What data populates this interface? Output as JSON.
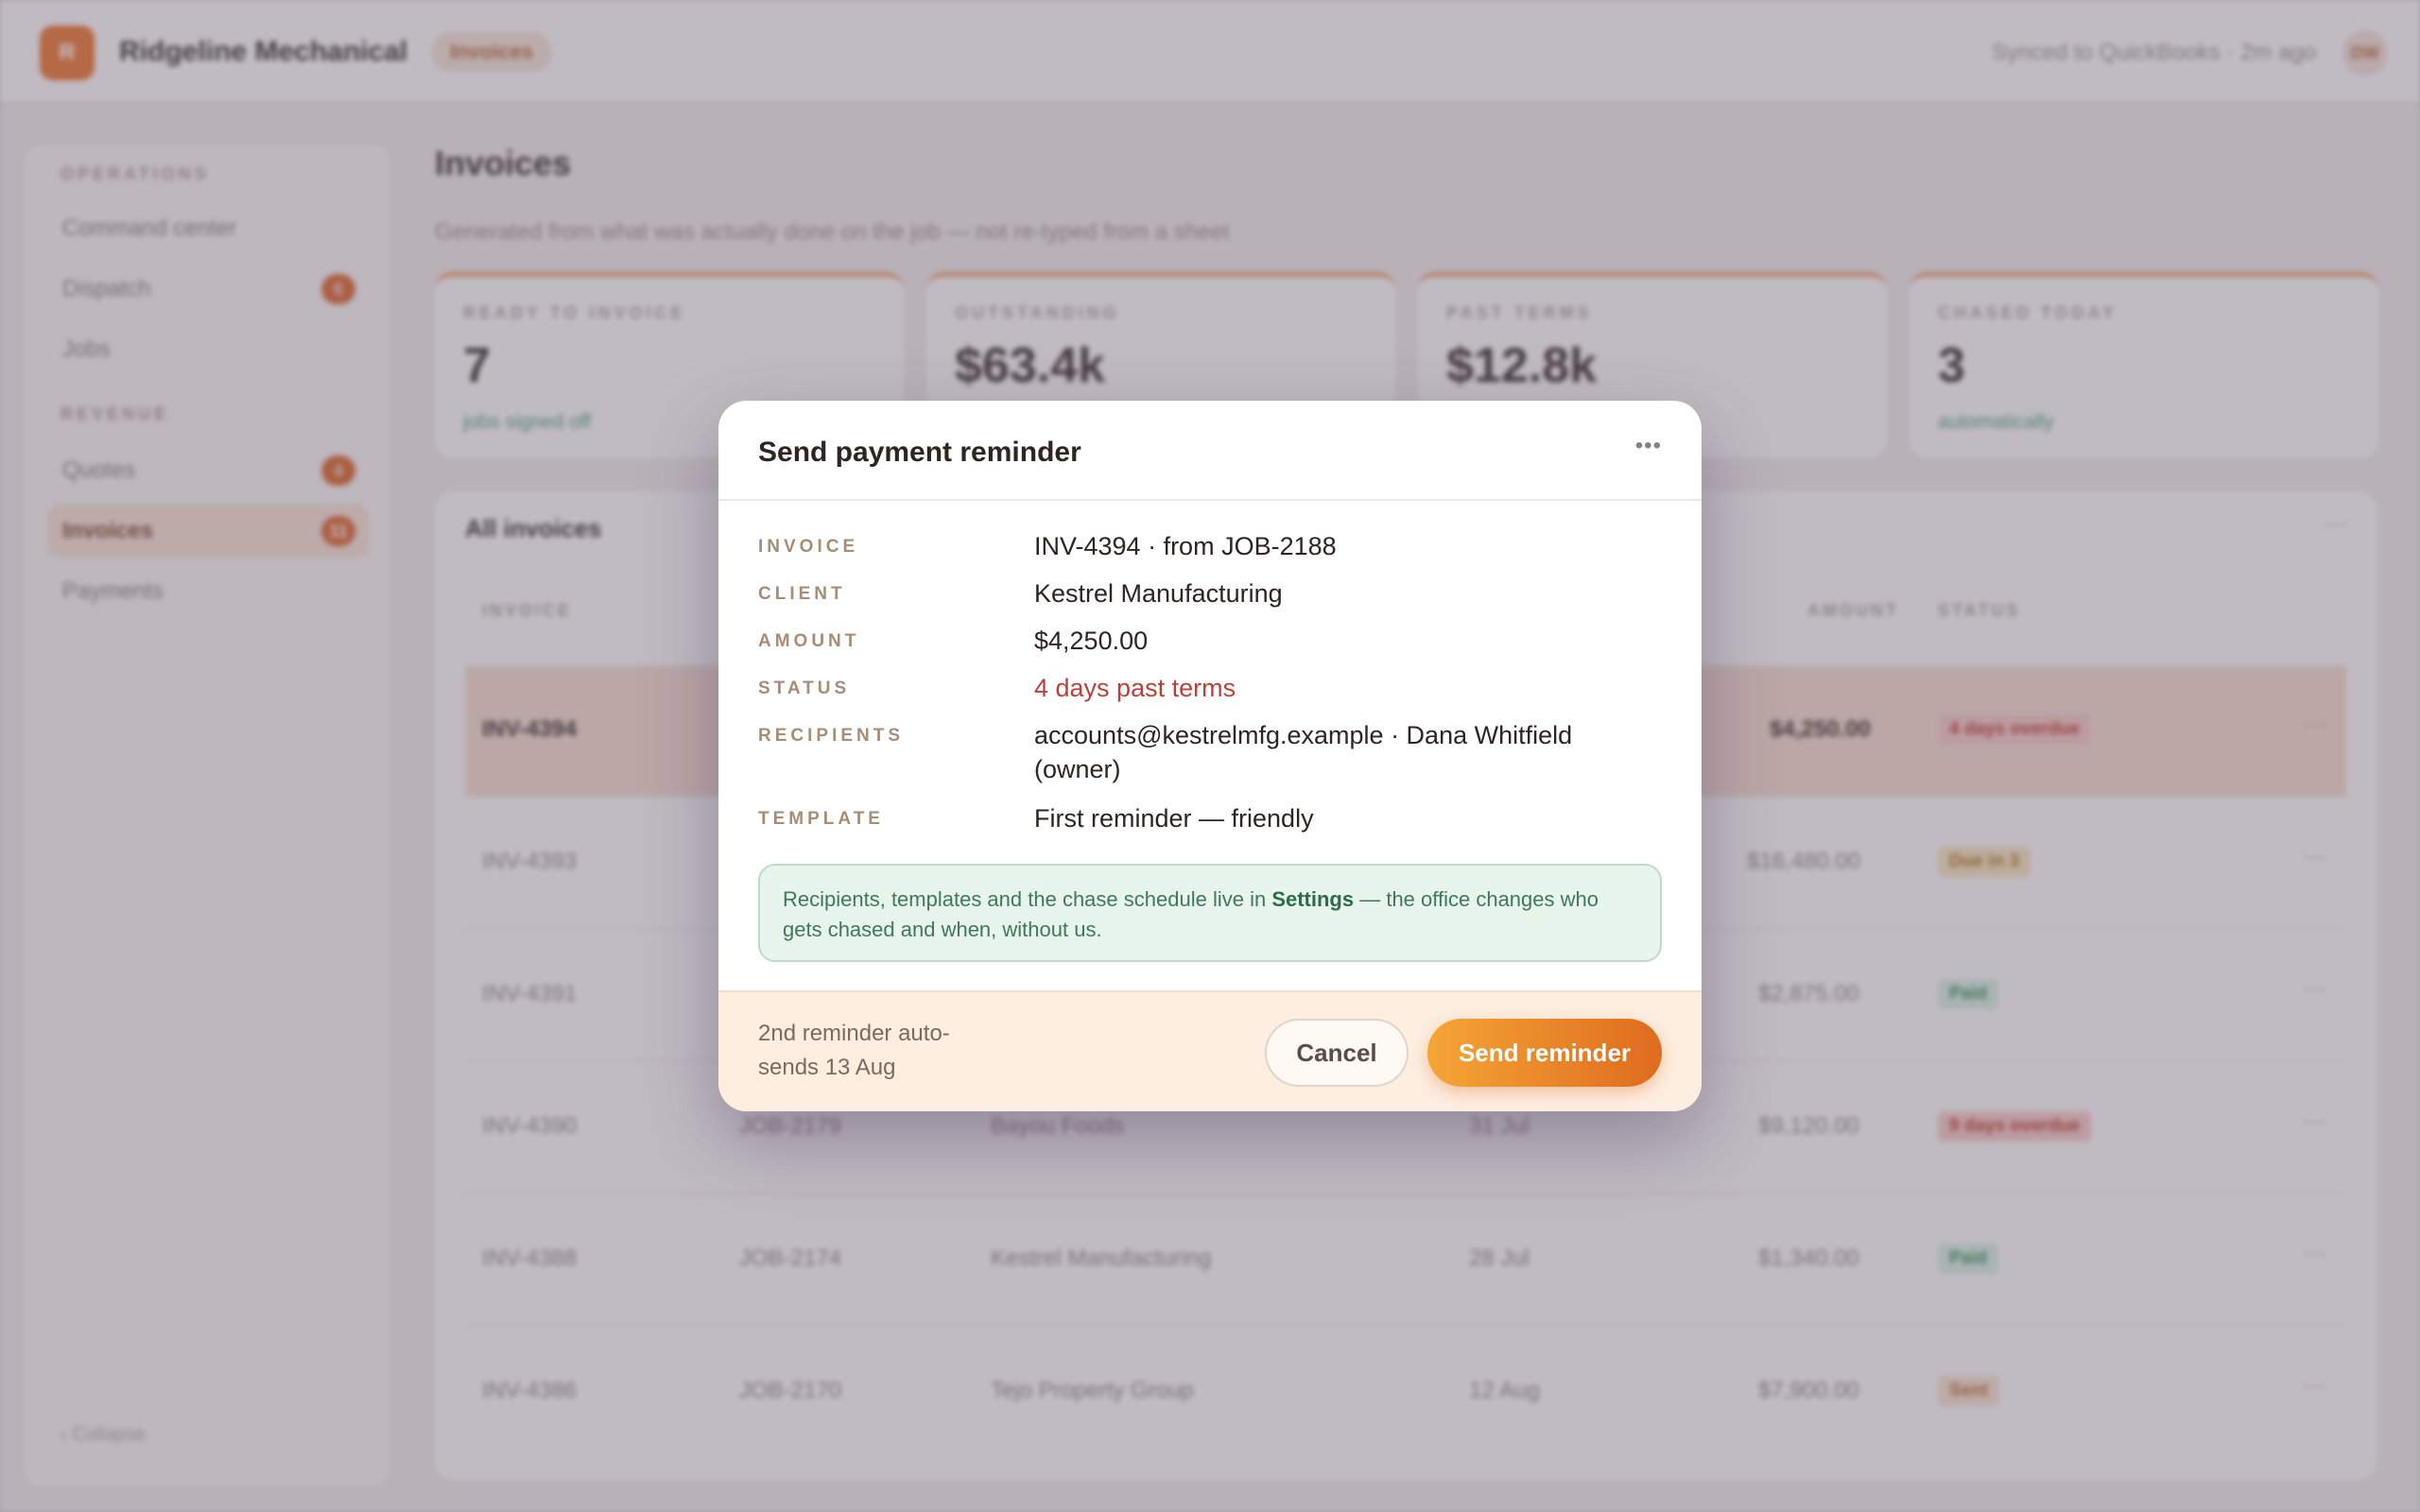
{
  "app": {
    "logo_letter": "R",
    "brand": "Ridgeline Mechanical",
    "breadcrumb": "Invoices",
    "sync_status": "Synced to QuickBooks · 2m ago",
    "avatar_initials": "DW"
  },
  "sidebar": {
    "sections": [
      "OPERATIONS",
      "REVENUE"
    ],
    "items": [
      {
        "label": "Command center",
        "badge": ""
      },
      {
        "label": "Dispatch",
        "badge": "6"
      },
      {
        "label": "Jobs",
        "badge": ""
      },
      {
        "label": "Quotes",
        "badge": "4"
      },
      {
        "label": "Invoices",
        "badge": "11"
      },
      {
        "label": "Payments",
        "badge": ""
      }
    ],
    "collapse_label": "‹ Collapse"
  },
  "page": {
    "title": "Invoices",
    "subtitle": "Generated from what was actually done on the job — not re-typed from a sheet"
  },
  "stats": [
    {
      "label": "READY TO INVOICE",
      "value": "7",
      "sub": "jobs signed off"
    },
    {
      "label": "OUTSTANDING",
      "value": "$63.4k",
      "sub": ""
    },
    {
      "label": "PAST TERMS",
      "value": "$12.8k",
      "sub": ""
    },
    {
      "label": "CHASED TODAY",
      "value": "3",
      "sub": "automatically"
    }
  ],
  "table": {
    "title": "All invoices",
    "headers": [
      "INVOICE",
      "AMOUNT",
      "STATUS"
    ],
    "rows": [
      {
        "invoice": "INV-4394",
        "job": "",
        "client": "",
        "date": "",
        "amount": "$4,250.00",
        "status": "4 days overdue"
      },
      {
        "invoice": "INV-4393",
        "job": "",
        "client": "",
        "date": "",
        "amount": "$16,480.00",
        "status": "Due in 3"
      },
      {
        "invoice": "INV-4391",
        "job": "",
        "client": "",
        "date": "",
        "amount": "$2,875.00",
        "status": "Paid"
      },
      {
        "invoice": "INV-4390",
        "job": "JOB-2179",
        "client": "Bayou Foods",
        "date": "31 Jul",
        "amount": "$9,120.00",
        "status": "9 days overdue"
      },
      {
        "invoice": "INV-4388",
        "job": "JOB-2174",
        "client": "Kestrel Manufacturing",
        "date": "28 Jul",
        "amount": "$1,340.00",
        "status": "Paid"
      },
      {
        "invoice": "INV-4386",
        "job": "JOB-2170",
        "client": "Tejo Property Group",
        "date": "12 Aug",
        "amount": "$7,900.00",
        "status": "Sent"
      }
    ]
  },
  "modal": {
    "title": "Send payment reminder",
    "fields": [
      {
        "label": "INVOICE",
        "value": "INV-4394 · from JOB-2188"
      },
      {
        "label": "CLIENT",
        "value": "Kestrel Manufacturing"
      },
      {
        "label": "AMOUNT",
        "value": "$4,250.00"
      },
      {
        "label": "STATUS",
        "value": "4 days past terms"
      },
      {
        "label": "RECIPIENTS",
        "value": "accounts@kestrelmfg.example · Dana Whitfield (owner)"
      },
      {
        "label": "TEMPLATE",
        "value": "First reminder — friendly"
      }
    ],
    "notice_pre": "Recipients, templates and the chase schedule live in ",
    "notice_link": "Settings",
    "notice_post": " — the office changes who gets chased and when, without us.",
    "footer_note": "2nd reminder auto-sends 13 Aug",
    "cancel_label": "Cancel",
    "send_label": "Send reminder"
  },
  "colors": {
    "accent": "#df6b1e",
    "danger": "#bf3f36",
    "success": "#3f7a58"
  }
}
